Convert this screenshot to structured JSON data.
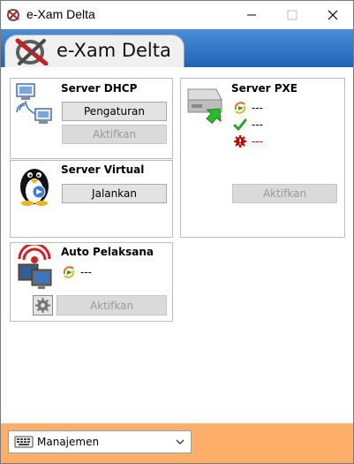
{
  "window": {
    "title": "e-Xam Delta",
    "controls": {
      "minimize": "minimize",
      "maximize": "maximize",
      "close": "close"
    }
  },
  "header": {
    "tab_title": "e-Xam Delta"
  },
  "panels": {
    "dhcp": {
      "title": "Server DHCP",
      "btn_primary": "Pengaturan",
      "btn_secondary": "Aktifkan"
    },
    "virtual": {
      "title": "Server Virtual",
      "btn_primary": "Jalankan"
    },
    "auto": {
      "title": "Auto Pelaksana",
      "status": "---",
      "btn_primary": "Aktifkan"
    },
    "pxe": {
      "title": "Server PXE",
      "status_1": "---",
      "status_2": "---",
      "status_3": "---",
      "btn_primary": "Aktifkan"
    }
  },
  "footer": {
    "selected": "Manajemen"
  },
  "colors": {
    "header_blue": "#1f62b6",
    "footer_orange": "#fdaf6a",
    "error_red": "#d40000"
  }
}
